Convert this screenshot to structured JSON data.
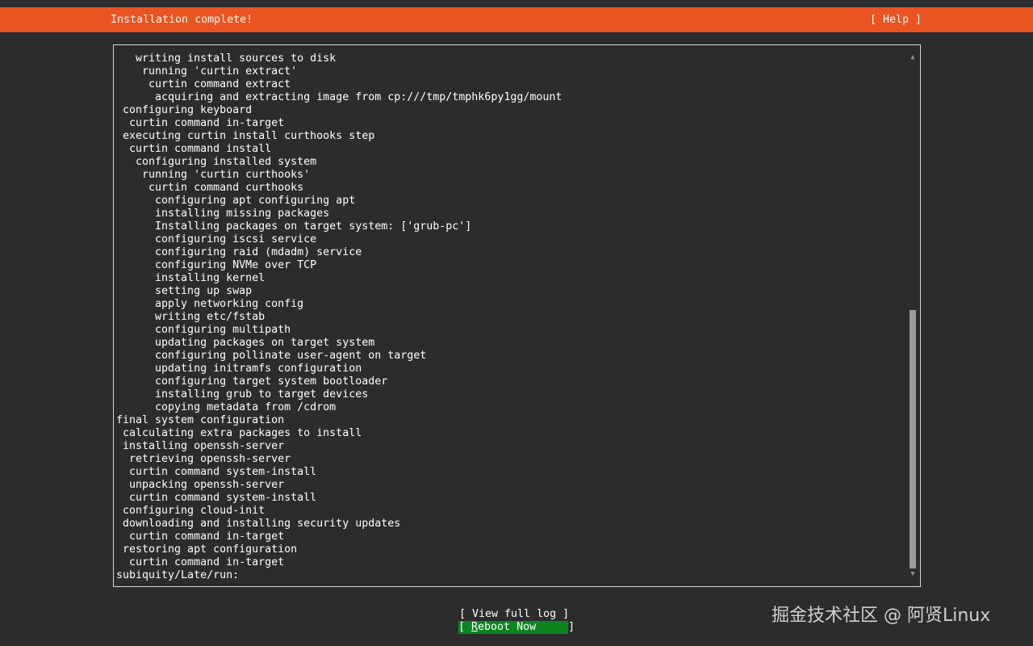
{
  "header": {
    "title": "Installation complete!",
    "help_label": "[ Help ]",
    "accent_color": "#e95420"
  },
  "log": {
    "lines": [
      "   writing install sources to disk",
      "    running 'curtin extract'",
      "     curtin command extract",
      "      acquiring and extracting image from cp:///tmp/tmphk6py1gg/mount",
      " configuring keyboard",
      "  curtin command in-target",
      " executing curtin install curthooks step",
      "  curtin command install",
      "   configuring installed system",
      "    running 'curtin curthooks'",
      "     curtin command curthooks",
      "      configuring apt configuring apt",
      "      installing missing packages",
      "      Installing packages on target system: ['grub-pc']",
      "      configuring iscsi service",
      "      configuring raid (mdadm) service",
      "      configuring NVMe over TCP",
      "      installing kernel",
      "      setting up swap",
      "      apply networking config",
      "      writing etc/fstab",
      "      configuring multipath",
      "      updating packages on target system",
      "      configuring pollinate user-agent on target",
      "      updating initramfs configuration",
      "      configuring target system bootloader",
      "      installing grub to target devices",
      "      copying metadata from /cdrom",
      "final system configuration",
      " calculating extra packages to install",
      " installing openssh-server",
      "  retrieving openssh-server",
      "  curtin command system-install",
      "  unpacking openssh-server",
      "  curtin command system-install",
      " configuring cloud-init",
      " downloading and installing security updates",
      "  curtin command in-target",
      " restoring apt configuration",
      "  curtin command in-target",
      "subiquity/Late/run:"
    ],
    "scroll_up_icon": "up-arrow-icon",
    "scroll_down_icon": "down-arrow-icon"
  },
  "buttons": {
    "view_log_label": "[ View full log ]",
    "reboot_open": "[ ",
    "reboot_hotkey": "R",
    "reboot_rest": "eboot Now     ]",
    "reboot_color": "#0e8420"
  },
  "watermark": {
    "text": "掘金技术社区 @ 阿贤Linux"
  }
}
